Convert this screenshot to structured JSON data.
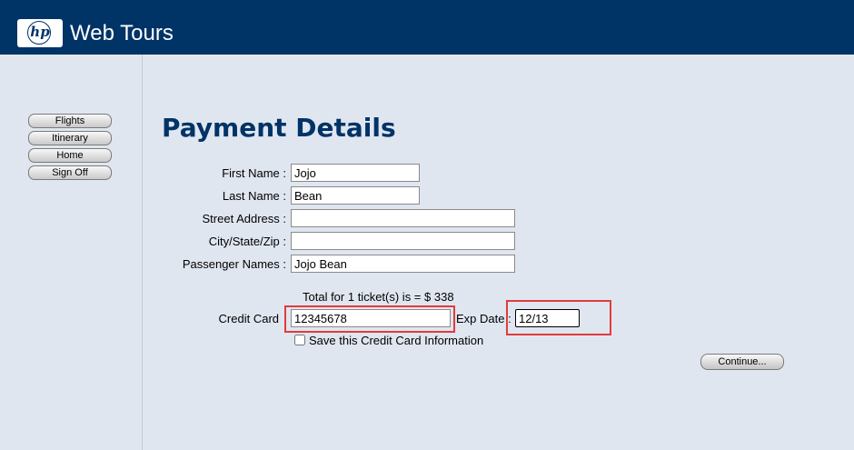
{
  "header": {
    "logo_text": "hp",
    "brand": "Web Tours",
    "background_color": "#003366"
  },
  "sidebar": {
    "items": [
      {
        "label": "Flights"
      },
      {
        "label": "Itinerary"
      },
      {
        "label": "Home"
      },
      {
        "label": "Sign Off"
      }
    ]
  },
  "main": {
    "title": "Payment Details",
    "form": {
      "first_name": {
        "label": "First Name :",
        "value": "Jojo"
      },
      "last_name": {
        "label": "Last Name :",
        "value": "Bean"
      },
      "street_address": {
        "label": "Street Address :",
        "value": ""
      },
      "city_state_zip": {
        "label": "City/State/Zip :",
        "value": ""
      },
      "passenger_names": {
        "label": "Passenger Names :",
        "value": "Jojo Bean"
      }
    },
    "total_text": "Total for 1 ticket(s) is = $ 338",
    "credit_card": {
      "label": "Credit Card",
      "value": "12345678"
    },
    "exp_date": {
      "label": "Exp Date :",
      "value": "12/13"
    },
    "save_cc": {
      "label": "Save this Credit Card Information",
      "checked": false
    },
    "continue_label": "Continue..."
  },
  "highlight_color": "#e03c3c"
}
